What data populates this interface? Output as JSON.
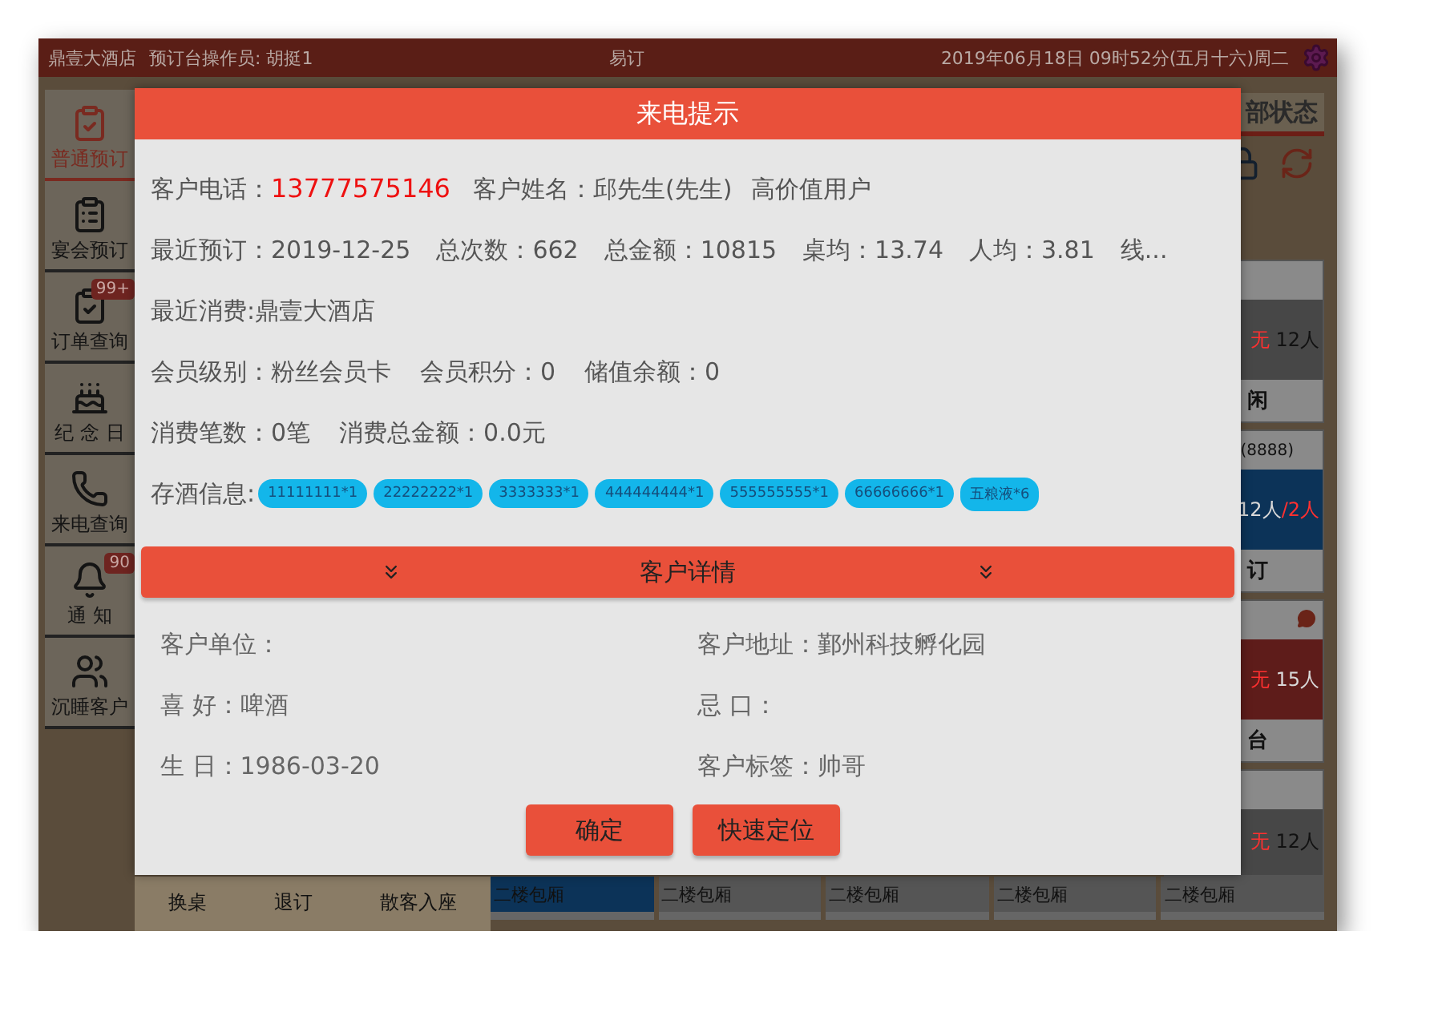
{
  "top_bar": {
    "hotel": "鼎壹大酒店",
    "operator": "预订台操作员: 胡挺1",
    "title": "易订",
    "datetime": "2019年06月18日 09时52分(五月十六)周二"
  },
  "sidebar": {
    "items": [
      {
        "label": "普通预订",
        "selected": true
      },
      {
        "label": "宴会预订",
        "selected": false
      },
      {
        "label": "订单查询",
        "selected": false,
        "badge": "99+"
      },
      {
        "label": "纪 念 日",
        "selected": false
      },
      {
        "label": "来电查询",
        "selected": false
      },
      {
        "label": "通 知",
        "selected": false,
        "badge": "90"
      },
      {
        "label": "沉睡客户",
        "selected": false
      }
    ]
  },
  "status_panel": {
    "title": "部状态"
  },
  "right_cards": [
    {
      "has_message": false,
      "kind": "idle",
      "status": "无",
      "people": "12人",
      "footer": "闲"
    },
    {
      "header": "(8888)",
      "has_message": false,
      "kind": "reserved",
      "people": "12人",
      "extra": "/2人",
      "footer": "订"
    },
    {
      "has_message": true,
      "kind": "locked",
      "status": "无",
      "people": "15人",
      "footer": "台"
    },
    {
      "has_message": false,
      "kind": "idle",
      "status": "无",
      "people": "12人"
    }
  ],
  "bottom_bar": {
    "actions": [
      "换桌",
      "退订",
      "散客入座"
    ],
    "tables": [
      {
        "name": "二楼包厢",
        "kind": "reserved"
      },
      {
        "name": "二楼包厢",
        "kind": "idle"
      },
      {
        "name": "二楼包厢",
        "kind": "idle"
      },
      {
        "name": "二楼包厢",
        "kind": "idle"
      },
      {
        "name": "二楼包厢",
        "kind": "idle"
      }
    ]
  },
  "dialog": {
    "title": "来电提示",
    "phone_label": "客户电话：",
    "phone": "13777575146",
    "name": "客户姓名：邱先生(先生)",
    "tag": "高价值用户",
    "stats": [
      "最近预订：2019-12-25",
      "总次数：662",
      "总金额：10815",
      "桌均：13.74",
      "人均：3.81",
      "线..."
    ],
    "last_consume": "最近消费:鼎壹大酒店",
    "member": [
      "会员级别：粉丝会员卡",
      "会员积分：0",
      "储值余额：0"
    ],
    "spend": [
      "消费笔数：0笔",
      "消费总金额：0.0元"
    ],
    "wine_label": "存酒信息:",
    "wine": [
      "11111111*1",
      "22222222*1",
      "3333333*1",
      "444444444*1",
      "555555555*1",
      "66666666*1",
      "五粮液*6"
    ],
    "details_title": "客户详情",
    "details": [
      "客户单位：",
      "客户地址：鄞州科技孵化园",
      "喜 好：啤酒",
      "忌 口：",
      "生 日：1986-03-20",
      "客户标签：帅哥"
    ],
    "buttons": [
      "确定",
      "快速定位"
    ]
  }
}
